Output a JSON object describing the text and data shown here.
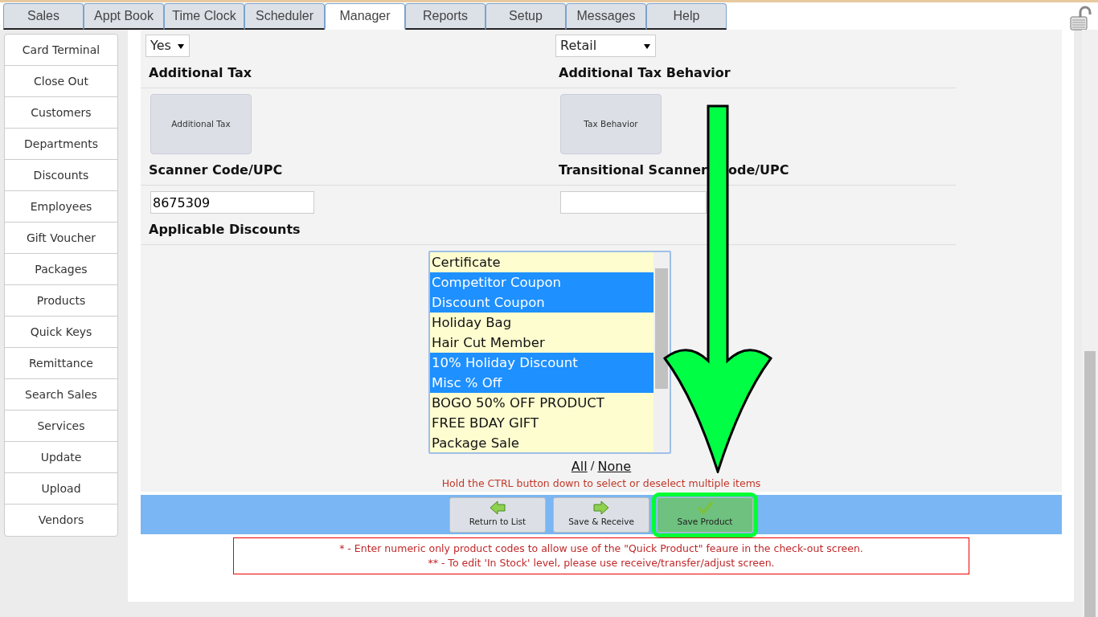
{
  "tabs": [
    {
      "label": "Sales",
      "selected": false
    },
    {
      "label": "Appt Book",
      "selected": false
    },
    {
      "label": "Time Clock",
      "selected": false
    },
    {
      "label": "Scheduler",
      "selected": false
    },
    {
      "label": "Manager",
      "selected": true
    },
    {
      "label": "Reports",
      "selected": false
    },
    {
      "label": "Setup",
      "selected": false
    },
    {
      "label": "Messages",
      "selected": false
    },
    {
      "label": "Help",
      "selected": false
    }
  ],
  "sidebar": {
    "items": [
      "Card Terminal",
      "Close Out",
      "Customers",
      "Departments",
      "Discounts",
      "Employees",
      "Gift Voucher",
      "Packages",
      "Products",
      "Quick Keys",
      "Remittance",
      "Search Sales",
      "Services",
      "Update",
      "Upload",
      "Vendors"
    ]
  },
  "form": {
    "selects": [
      {
        "value": "Yes"
      },
      {
        "value": "Retail"
      }
    ],
    "additional_tax": {
      "label": "Additional Tax",
      "button": "Additional Tax"
    },
    "tax_behavior": {
      "label": "Additional Tax Behavior",
      "button": "Tax Behavior"
    },
    "scanner_code": {
      "label": "Scanner Code/UPC",
      "value": "8675309"
    },
    "transitional_code": {
      "label_parts": [
        "Transitional Scanner",
        "ode/UPC"
      ]
    },
    "discounts": {
      "label": "Applicable Discounts",
      "items": [
        {
          "label": "Certificate",
          "selected": false
        },
        {
          "label": "Competitor Coupon",
          "selected": true
        },
        {
          "label": "Discount Coupon",
          "selected": true
        },
        {
          "label": "Holiday Bag",
          "selected": false
        },
        {
          "label": "Hair Cut Member",
          "selected": false
        },
        {
          "label": "10% Holiday Discount",
          "selected": true
        },
        {
          "label": "Misc % Off",
          "selected": true
        },
        {
          "label": "BOGO 50% OFF PRODUCT",
          "selected": false
        },
        {
          "label": "FREE BDAY GIFT",
          "selected": false
        },
        {
          "label": "Package Sale",
          "selected": false
        }
      ],
      "all_link": "All",
      "separator": "/",
      "none_link": "None",
      "hint": "Hold the CTRL button down to select or deselect multiple items"
    }
  },
  "actions": [
    {
      "label": "Return to List",
      "kind": "back",
      "highlighted": false
    },
    {
      "label": "Save & Receive",
      "kind": "forward",
      "highlighted": false
    },
    {
      "label": "Save Product",
      "kind": "save",
      "highlighted": true
    }
  ],
  "notes": [
    "* - Enter numeric only product codes to allow use of the \"Quick Product\" feaure in the check-out screen.",
    "** - To edit 'In Stock' level, please use receive/transfer/adjust screen."
  ]
}
